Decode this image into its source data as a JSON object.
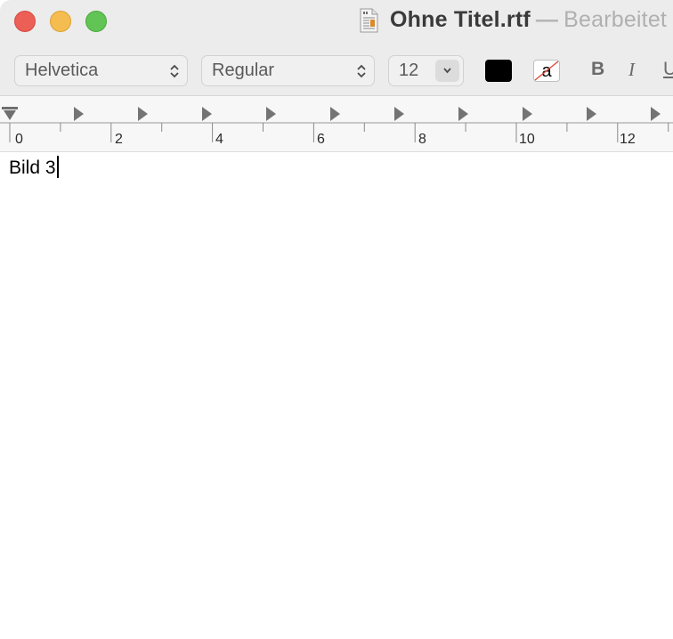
{
  "window": {
    "title": "Ohne Titel.rtf",
    "separator": "—",
    "state": "Bearbeitet"
  },
  "toolbar": {
    "font_family": "Helvetica",
    "font_style": "Regular",
    "font_size": "12",
    "text_color": "#000000",
    "highlight_letter": "a",
    "bold_label": "B",
    "italic_label": "I",
    "underline_label": "U"
  },
  "ruler": {
    "labels": [
      "0",
      "2",
      "4",
      "6",
      "8",
      "10",
      "12"
    ]
  },
  "document": {
    "text": "Bild 3"
  },
  "colors": {
    "close": "#ec5f57",
    "minimize": "#f5bd4f",
    "zoom": "#61c454"
  },
  "icons": [
    "doc-icon",
    "chevron-updown-icon",
    "chevron-down-icon",
    "no-highlight-icon",
    "tab-stop-icon",
    "indent-marker-icon"
  ]
}
